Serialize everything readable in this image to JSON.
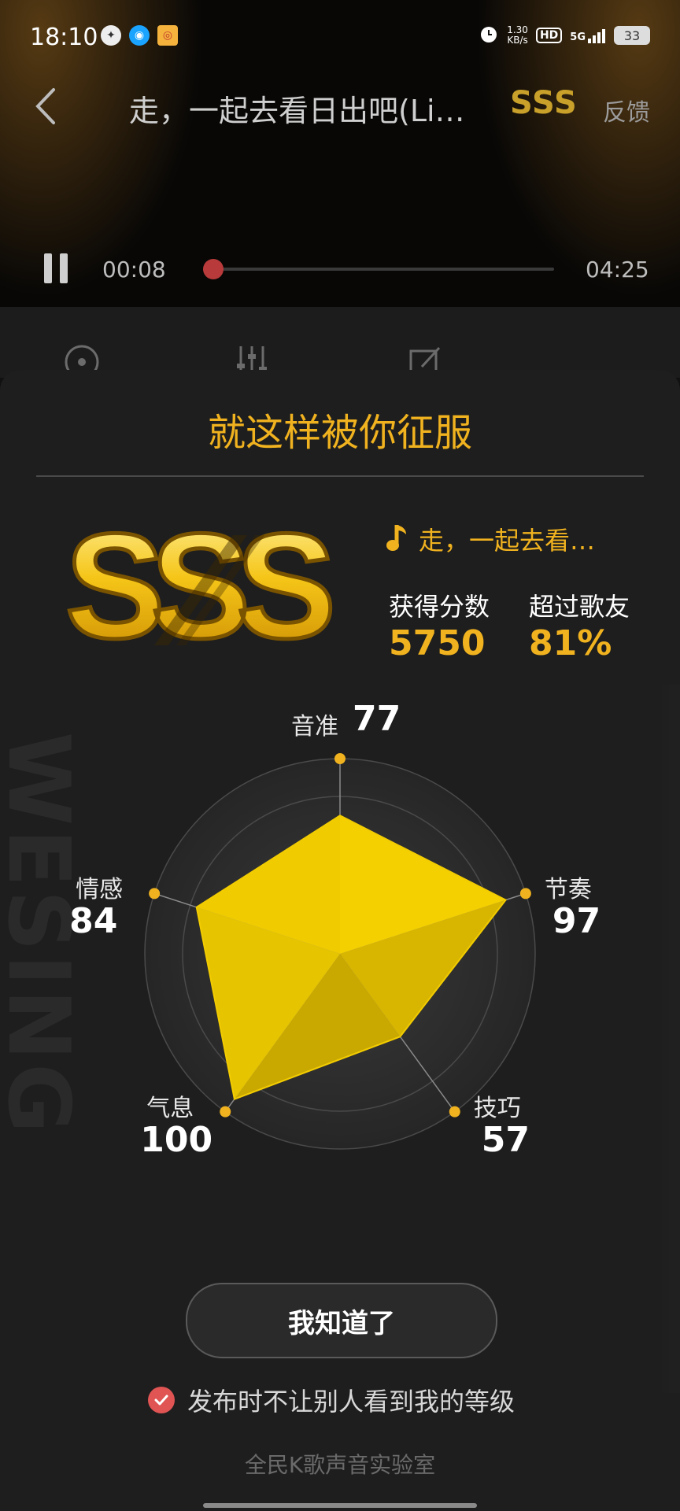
{
  "status_bar": {
    "time": "18:10",
    "speed_value": "1.30",
    "speed_unit": "KB/s",
    "hd": "HD",
    "network": "5G",
    "battery": "33"
  },
  "header": {
    "song_title": "走，一起去看日出吧(Li…",
    "grade": "SSS",
    "feedback": "反馈"
  },
  "player": {
    "current_time": "00:08",
    "total_time": "04:25",
    "progress": 0.03
  },
  "result": {
    "title": "就这样被你征服",
    "grade_badge": "SSS",
    "song_short": "走，一起去看…",
    "score_label": "获得分数",
    "score_value": "5750",
    "beat_label": "超过歌友",
    "beat_value": "81%"
  },
  "radar": {
    "axes": [
      {
        "label": "音准",
        "value": 77
      },
      {
        "label": "节奏",
        "value": 97
      },
      {
        "label": "技巧",
        "value": 57
      },
      {
        "label": "气息",
        "value": 100
      },
      {
        "label": "情感",
        "value": 84
      }
    ]
  },
  "actions": {
    "ok_label": "我知道了",
    "hide_grade_label": "发布时不让别人看到我的等级",
    "hide_grade_checked": true,
    "footer": "全民K歌声音实验室"
  },
  "watermark": "WESING",
  "colors": {
    "accent": "#f0b21f",
    "radar_fill": "#f2cc00",
    "check": "#e05454",
    "progress": "#b83a3a"
  }
}
